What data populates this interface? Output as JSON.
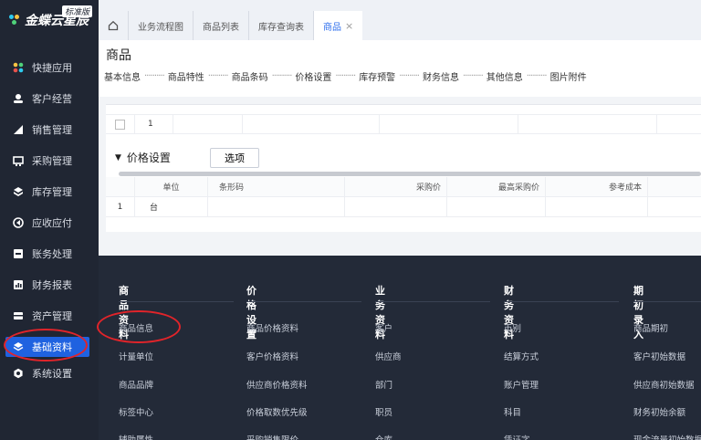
{
  "app": {
    "brand": "金蝶云星辰",
    "edition": "标准版"
  },
  "sidebar": {
    "items": [
      {
        "label": "快捷应用",
        "icon": "apps-icon"
      },
      {
        "label": "客户经营",
        "icon": "customer-icon"
      },
      {
        "label": "销售管理",
        "icon": "sales-icon"
      },
      {
        "label": "采购管理",
        "icon": "purchase-icon"
      },
      {
        "label": "库存管理",
        "icon": "inventory-icon"
      },
      {
        "label": "应收应付",
        "icon": "receivable-icon"
      },
      {
        "label": "账务处理",
        "icon": "ledger-icon"
      },
      {
        "label": "财务报表",
        "icon": "report-icon"
      },
      {
        "label": "资产管理",
        "icon": "asset-icon"
      },
      {
        "label": "基础资料",
        "icon": "layers-icon"
      },
      {
        "label": "系统设置",
        "icon": "settings-icon"
      }
    ]
  },
  "tabs": [
    {
      "label": "业务流程图"
    },
    {
      "label": "商品列表"
    },
    {
      "label": "库存查询表"
    },
    {
      "label": "商品",
      "close": "×"
    }
  ],
  "page": {
    "title": "商品",
    "steps": [
      "基本信息",
      "商品特性",
      "商品条码",
      "价格设置",
      "库存预警",
      "财务信息",
      "其他信息",
      "图片附件"
    ],
    "step_separator": "··········"
  },
  "table1": {
    "row_no": "1"
  },
  "price": {
    "caret": "▼",
    "title": "价格设置",
    "options_button": "选项",
    "columns": [
      "单位",
      "条形码",
      "采购价",
      "最高采购价",
      "参考成本"
    ],
    "rows": [
      {
        "no": "1",
        "unit": "台"
      }
    ]
  },
  "dropdown": {
    "columns": [
      {
        "title": "商品资料",
        "items": [
          "商品信息",
          "计量单位",
          "商品品牌",
          "标签中心",
          "辅助属性"
        ]
      },
      {
        "title": "价格设置",
        "items": [
          "商品价格资料",
          "客户价格资料",
          "供应商价格资料",
          "价格取数优先级",
          "采购销售限价"
        ]
      },
      {
        "title": "业务资料",
        "items": [
          "客户",
          "供应商",
          "部门",
          "职员",
          "仓库"
        ]
      },
      {
        "title": "财务资料",
        "items": [
          "币别",
          "结算方式",
          "账户管理",
          "科目",
          "凭证字"
        ]
      },
      {
        "title": "期初录入",
        "items": [
          "商品期初",
          "客户初始数据",
          "供应商初始数据",
          "财务初始余额",
          "现金流量初始数据"
        ]
      }
    ]
  },
  "colors": {
    "sidebar_bg": "#202633",
    "active_blue": "#1f62e0",
    "dropdown_bg": "#232a38",
    "highlight_red": "#e1242a",
    "tab_active_text": "#2f6fed"
  }
}
